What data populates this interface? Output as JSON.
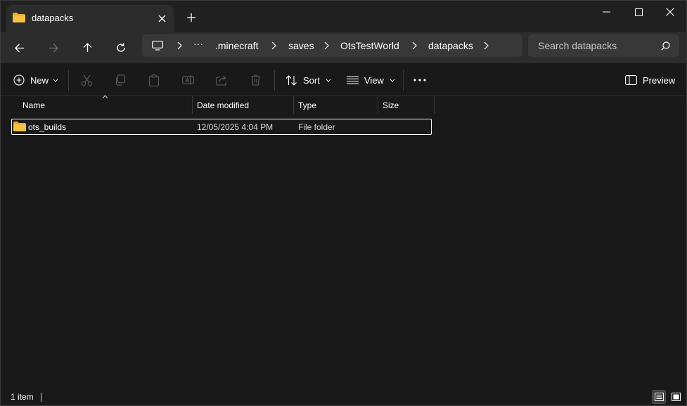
{
  "tab": {
    "title": "datapacks",
    "icon": "folder-icon"
  },
  "address": {
    "crumbs": [
      ".minecraft",
      "saves",
      "OtsTestWorld",
      "datapacks"
    ],
    "overflow": "···"
  },
  "search": {
    "placeholder": "Search datapacks"
  },
  "commands": {
    "new_label": "New",
    "sort_label": "Sort",
    "view_label": "View",
    "more_label": "···",
    "preview_label": "Preview"
  },
  "columns": {
    "name": "Name",
    "date": "Date modified",
    "type": "Type",
    "size": "Size"
  },
  "files": [
    {
      "name": "ots_builds",
      "date": "12/05/2025 4:04 PM",
      "type": "File folder",
      "size": ""
    }
  ],
  "status": {
    "count": "1 item"
  },
  "colors": {
    "folder": "#F5C242",
    "background": "#191919",
    "accent": "#ffffff"
  }
}
